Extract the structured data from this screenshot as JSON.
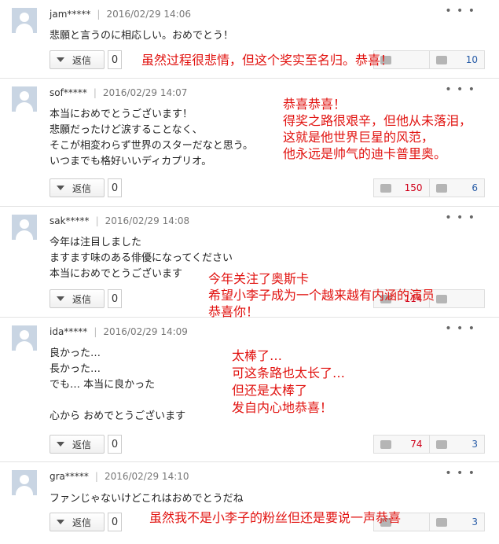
{
  "ui": {
    "reply_label": "返信",
    "more": "• • •"
  },
  "comments": [
    {
      "user": "jam*****",
      "time": "2016/02/29 14:06",
      "lines": [
        "悲願と言うのに相応しい。おめでとう！"
      ],
      "reply_count": "0",
      "up": "",
      "down": "10",
      "note": [
        "虽然过程很悲情，但这个奖实至名归。恭喜！"
      ]
    },
    {
      "user": "sof*****",
      "time": "2016/02/29 14:07",
      "lines": [
        "本当におめでとうございます！",
        "悲願だったけど涙することなく、",
        "そこが相変わらず世界のスターだなと思う。",
        "いつまでも格好いいディカプリオ。"
      ],
      "reply_count": "0",
      "up": "150",
      "down": "6",
      "note": [
        "恭喜恭喜！",
        "得奖之路很艰辛，但他从未落泪，",
        "这就是他世界巨星的风范，",
        "他永远是帅气的迪卡普里奥。"
      ]
    },
    {
      "user": "sak*****",
      "time": "2016/02/29 14:08",
      "lines": [
        "今年は注目しました",
        "ますます味のある俳優になってください",
        "本当におめでとうございます"
      ],
      "reply_count": "0",
      "up": "114",
      "down": "",
      "note": [
        "今年关注了奥斯卡",
        "希望小李子成为一个越来越有内涵的演员",
        "恭喜你！"
      ]
    },
    {
      "user": "ida*****",
      "time": "2016/02/29 14:09",
      "lines": [
        "良かった…",
        "長かった…",
        "でも… 本当に良かった",
        "",
        "心から おめでとうございます"
      ],
      "reply_count": "0",
      "up": "74",
      "down": "3",
      "note": [
        "太棒了…",
        "可这条路也太长了…",
        "但还是太棒了",
        "发自内心地恭喜！"
      ]
    },
    {
      "user": "gra*****",
      "time": "2016/02/29 14:10",
      "lines": [
        "ファンじゃないけどこれはおめでとうだね"
      ],
      "reply_count": "0",
      "up": "",
      "down": "3",
      "note": [
        "虽然我不是小李子的粉丝但还是要说一声恭喜"
      ]
    }
  ]
}
